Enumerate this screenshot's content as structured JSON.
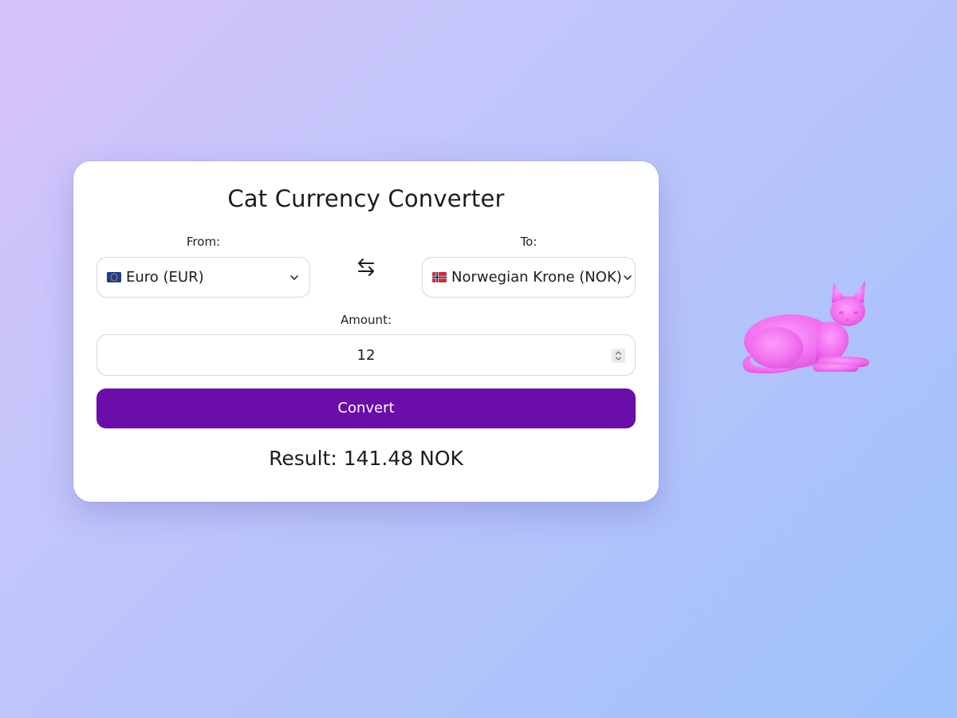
{
  "converter": {
    "title": "Cat Currency Converter",
    "from_label": "From:",
    "to_label": "To:",
    "from_currency": "Euro (EUR)",
    "to_currency": "Norwegian Krone (NOK)",
    "amount_label": "Amount:",
    "amount_value": "12",
    "convert_label": "Convert",
    "result_text": "Result: 141.48 NOK"
  },
  "icons": {
    "from_flag": "eu-flag-icon",
    "to_flag": "norway-flag-icon",
    "swap": "swap-arrows-icon",
    "dropdown": "chevron-down-icon",
    "decoration": "pink-cat-figure"
  },
  "colors": {
    "accent": "#6a0dab",
    "cat": "#f26ff0",
    "card": "#ffffff"
  }
}
